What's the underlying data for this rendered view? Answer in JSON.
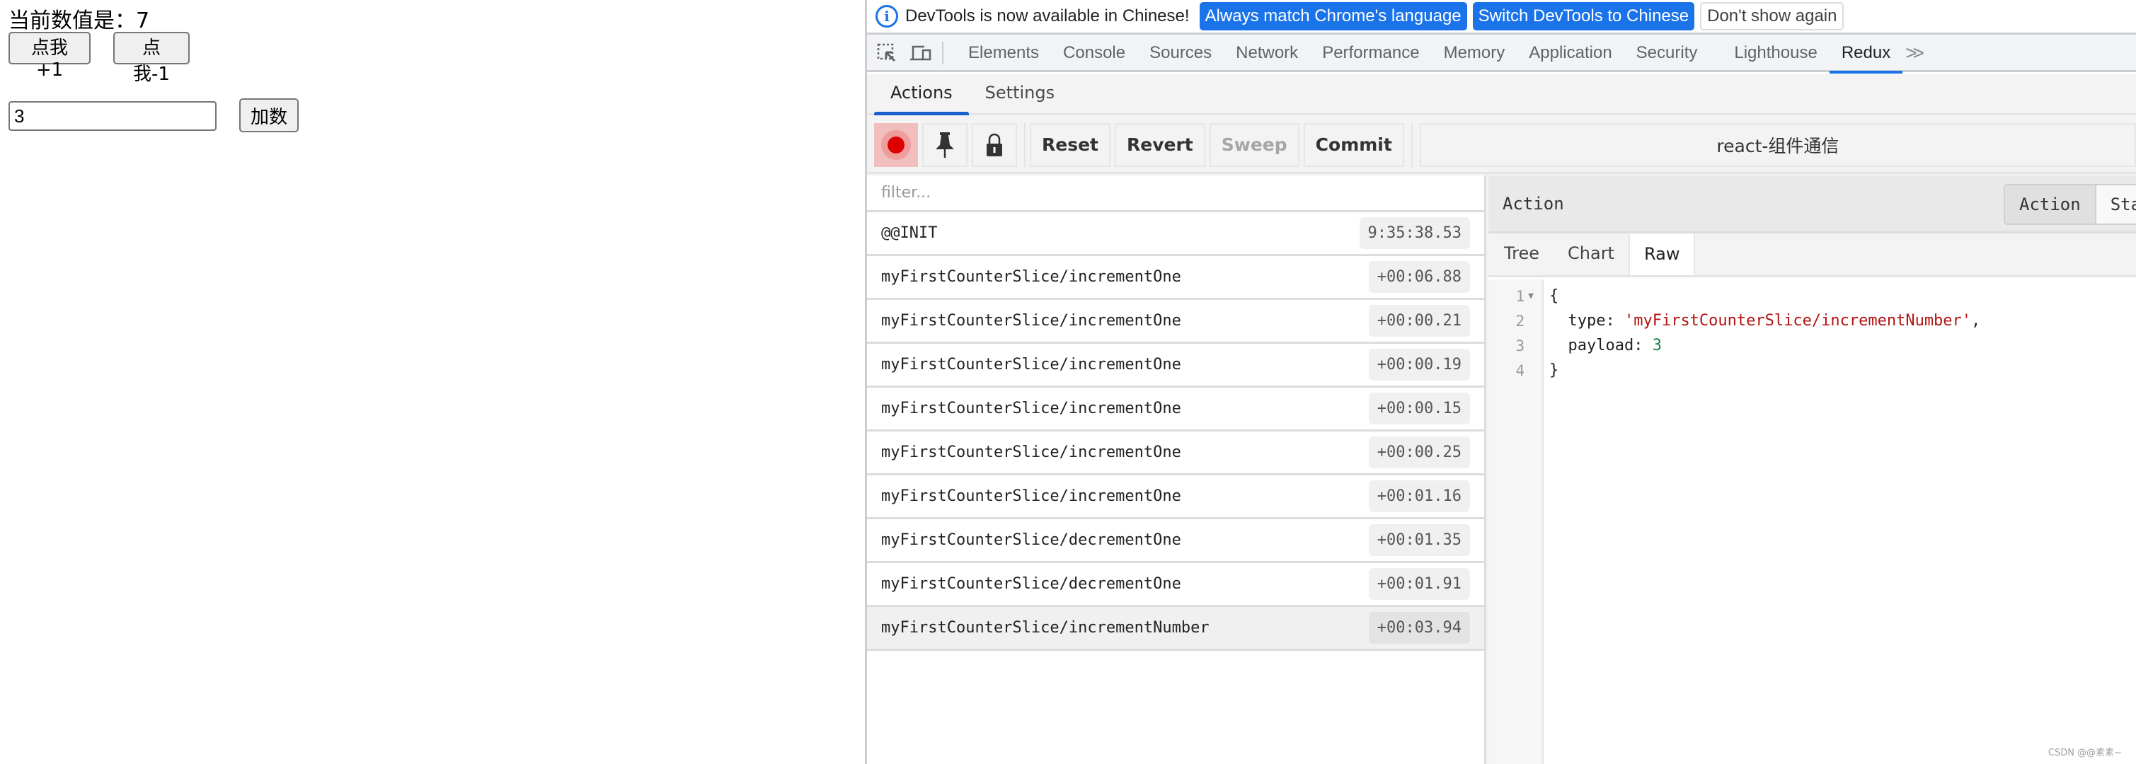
{
  "page": {
    "title_prefix": "当前数值是：",
    "current_value": "7",
    "increment_button": "点我+1",
    "decrement_button": "点我-1",
    "number_input_value": "3",
    "add_button": "加数"
  },
  "devtools": {
    "infobar": {
      "message": "DevTools is now available in Chinese!",
      "buttons": [
        "Always match Chrome's language",
        "Switch DevTools to Chinese",
        "Don't show again"
      ]
    },
    "tabs": [
      "Elements",
      "Console",
      "Sources",
      "Network",
      "Performance",
      "Memory",
      "Application",
      "Security",
      "Lighthouse",
      "Redux"
    ],
    "active_tab": "Redux",
    "more_tabs_icon": "»"
  },
  "redux": {
    "tabs": [
      "Actions",
      "Settings"
    ],
    "active_tab": "Actions",
    "toolbar": {
      "record_icon": "record-icon",
      "pin_icon": "pin-icon",
      "lock_icon": "lock-icon",
      "reset": "Reset",
      "revert": "Revert",
      "sweep": "Sweep",
      "commit": "Commit",
      "instance": "react-组件通信"
    },
    "filter_placeholder": "filter...",
    "actions": [
      {
        "name": "@@INIT",
        "time": "9:35:38.53"
      },
      {
        "name": "myFirstCounterSlice/incrementOne",
        "time": "+00:06.88"
      },
      {
        "name": "myFirstCounterSlice/incrementOne",
        "time": "+00:00.21"
      },
      {
        "name": "myFirstCounterSlice/incrementOne",
        "time": "+00:00.19"
      },
      {
        "name": "myFirstCounterSlice/incrementOne",
        "time": "+00:00.15"
      },
      {
        "name": "myFirstCounterSlice/incrementOne",
        "time": "+00:00.25"
      },
      {
        "name": "myFirstCounterSlice/incrementOne",
        "time": "+00:01.16"
      },
      {
        "name": "myFirstCounterSlice/decrementOne",
        "time": "+00:01.35"
      },
      {
        "name": "myFirstCounterSlice/decrementOne",
        "time": "+00:01.91"
      },
      {
        "name": "myFirstCounterSlice/incrementNumber",
        "time": "+00:03.94",
        "selected": true
      }
    ],
    "detail": {
      "header": "Action",
      "segments": [
        "Action",
        "Sta"
      ],
      "active_segment": "Action",
      "subtabs": [
        "Tree",
        "Chart",
        "Raw"
      ],
      "active_subtab": "Raw",
      "code": {
        "line_numbers": [
          "1",
          "2",
          "3",
          "4"
        ],
        "open_brace": "{",
        "type_key": "  type: ",
        "type_value": "'myFirstCounterSlice/incrementNumber'",
        "type_comma": ",",
        "payload_key": "  payload: ",
        "payload_value": "3",
        "close_brace": "}"
      }
    }
  },
  "watermark": "CSDN @@素素~"
}
